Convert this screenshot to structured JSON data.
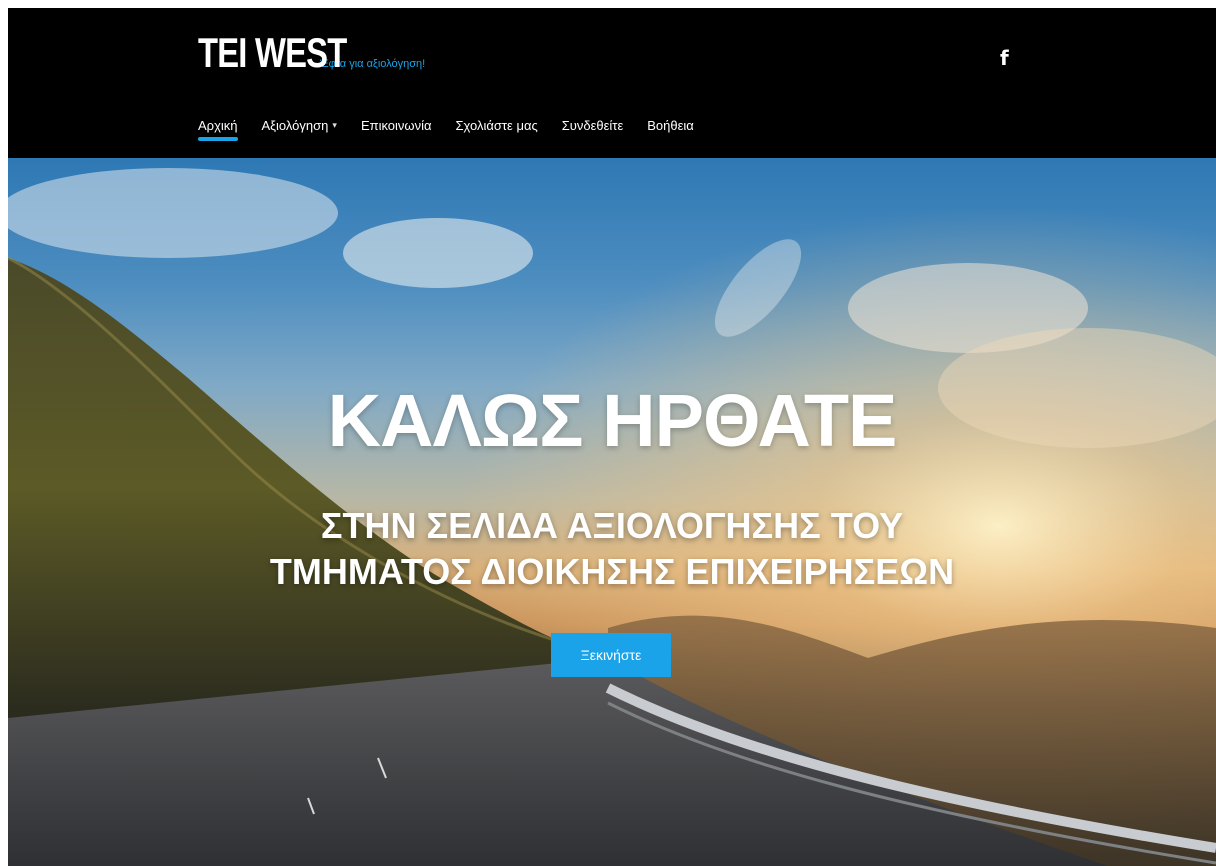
{
  "header": {
    "brand_title": "TEI WEST",
    "brand_tagline": "Έφτα για αξιολόγηση!",
    "social_icon": "facebook-icon",
    "social_glyph": "f"
  },
  "nav": {
    "items": [
      {
        "label": "Αρχική",
        "active": true
      },
      {
        "label": "Αξιολόγηση",
        "dropdown": true
      },
      {
        "label": "Επικοινωνία"
      },
      {
        "label": "Σχολιάστε μας"
      },
      {
        "label": "Συνδεθείτε"
      },
      {
        "label": "Βοήθεια"
      }
    ],
    "caret_glyph": "▾"
  },
  "hero": {
    "title": "ΚΑΛΩΣ ΗΡΘΑΤΕ",
    "subtitle_line1": "ΣΤΗΝ ΣΕΛΙΔΑ ΑΞΙΟΛΟΓΗΣΗΣ ΤΟΥ",
    "subtitle_line2": "ΤΜΗΜΑΤΟΣ ΔΙΟΙΚΗΣΗΣ ΕΠΙΧΕΙΡΗΣΕΩΝ",
    "cta_label": "Ξεκινήστε"
  },
  "colors": {
    "accent": "#1aa3e8",
    "header_bg": "#000000"
  }
}
